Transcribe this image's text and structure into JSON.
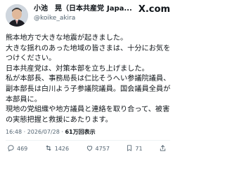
{
  "author": {
    "name": "小池　晃（日本共産党",
    "truncation": "Japa...",
    "handle": "@koike_akira"
  },
  "brand": {
    "logo_text": "X.com"
  },
  "post": {
    "lines": [
      "熊本地方で大きな地震が起きました。",
      "大きな揺れのあった地域の皆さまは、十分にお気を",
      "つけください。",
      "日本共産党は、対策本部を立ち上げました。",
      "私が本部長、事務局長は仁比そうへい参議院議員、",
      "副本部長は白川よう子参議院議員。国会議員全員が",
      "本部員に。",
      "現地の党組織や地方議員と連絡を取り合って、被害",
      "の実態把握と救援にあたります。"
    ]
  },
  "meta": {
    "time": "16:48",
    "separator": "·",
    "date": "2026/07/28",
    "views": "61万回表示"
  },
  "actions": {
    "reply_count": "469",
    "repost_count": "1426",
    "like_count": "4757",
    "bookmark_count": "71"
  }
}
